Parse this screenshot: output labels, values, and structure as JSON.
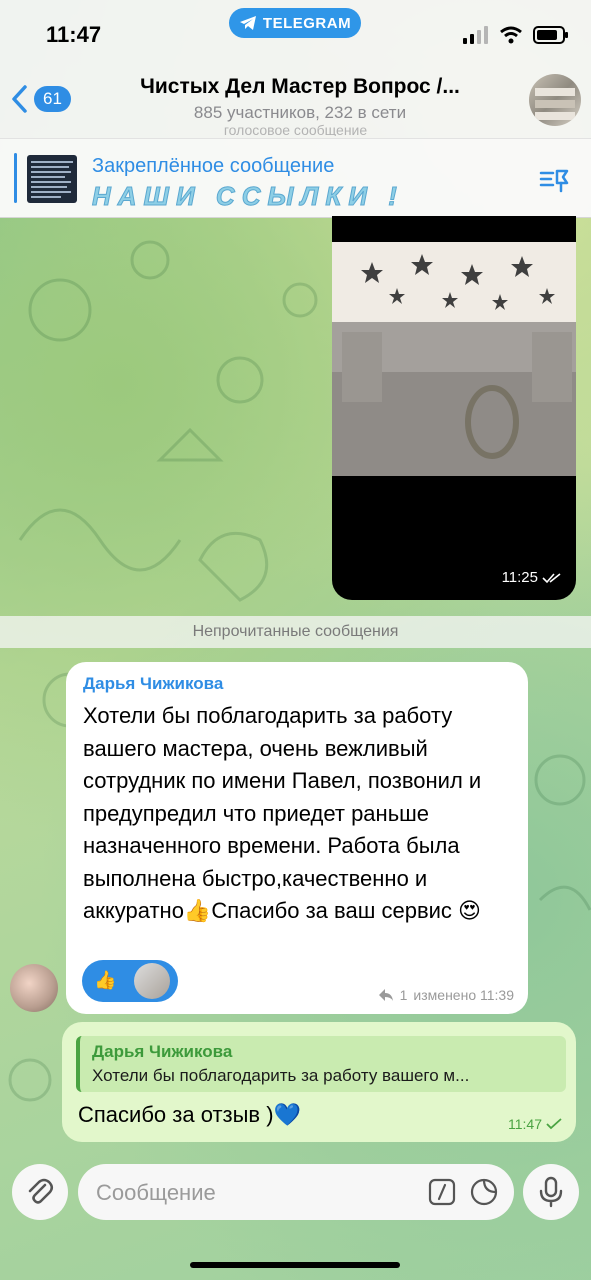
{
  "status": {
    "time": "11:47",
    "app_pill": "TELEGRAM"
  },
  "header": {
    "back_count": "61",
    "title": "Чистых Дел Мастер Вопрос /...",
    "subtitle": "885 участников, 232 в сети",
    "faded_line": "голосовое сообщение"
  },
  "pinned": {
    "title": "Закреплённое сообщение",
    "text": "НАШИ ССЫЛКИ !"
  },
  "photo_message": {
    "time": "11:25"
  },
  "divider": {
    "unread_label": "Непрочитанные сообщения"
  },
  "incoming": {
    "author": "Дарья Чижикова",
    "text": "Хотели бы поблагодарить за работу вашего мастера, очень вежливый сотрудник по имени Павел, позвонил и предупредил что приедет раньше назначенного времени. Работа была выполнена быстро,качественно и аккуратно👍Спасибо за ваш сервис 😍",
    "reaction_emoji": "👍",
    "replies_count": "1",
    "meta": "изменено 11:39"
  },
  "outgoing": {
    "reply_author": "Дарья Чижикова",
    "reply_text": "Хотели бы поблагодарить за работу вашего м...",
    "text": "Спасибо за отзыв )💙",
    "time": "11:47"
  },
  "input": {
    "placeholder": "Сообщение"
  },
  "colors": {
    "accent": "#2f8de4",
    "outgoing_bubble": "#e2f7cb",
    "green_accent": "#4aa342"
  }
}
